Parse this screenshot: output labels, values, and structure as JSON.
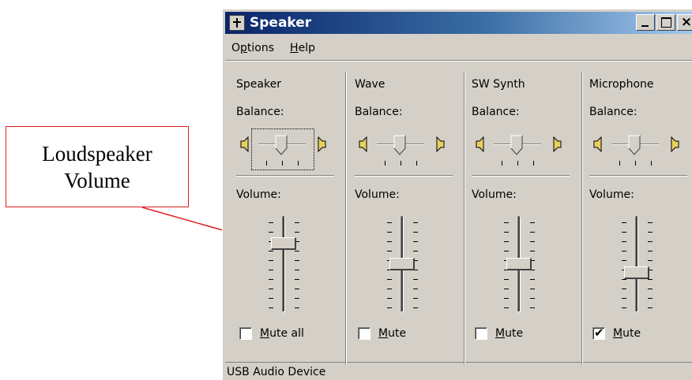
{
  "callout": {
    "line1": "Loudspeaker",
    "line2": "Volume"
  },
  "window": {
    "title": "Speaker",
    "close_glyph": "×"
  },
  "menu": {
    "items": [
      {
        "label": "Options",
        "mnemonic": "p"
      },
      {
        "label": "Help",
        "mnemonic": "H"
      }
    ]
  },
  "channels": [
    {
      "name": "Speaker",
      "balance_label": "Balance:",
      "volume_label": "Volume:",
      "volume_level": 0.75,
      "mute_label": "Mute all",
      "muted": false
    },
    {
      "name": "Wave",
      "balance_label": "Balance:",
      "volume_label": "Volume:",
      "volume_level": 0.5,
      "mute_label": "Mute",
      "muted": false
    },
    {
      "name": "SW Synth",
      "balance_label": "Balance:",
      "volume_label": "Volume:",
      "volume_level": 0.5,
      "mute_label": "Mute",
      "muted": false
    },
    {
      "name": "Microphone",
      "balance_label": "Balance:",
      "volume_label": "Volume:",
      "volume_level": 0.4,
      "mute_label": "Mute",
      "muted": true
    }
  ],
  "status": {
    "text": "USB Audio Device"
  },
  "colors": {
    "title_start": "#0a246a",
    "title_end": "#a6caf0",
    "face": "#d4d0c8",
    "callout_border": "#e02020"
  }
}
